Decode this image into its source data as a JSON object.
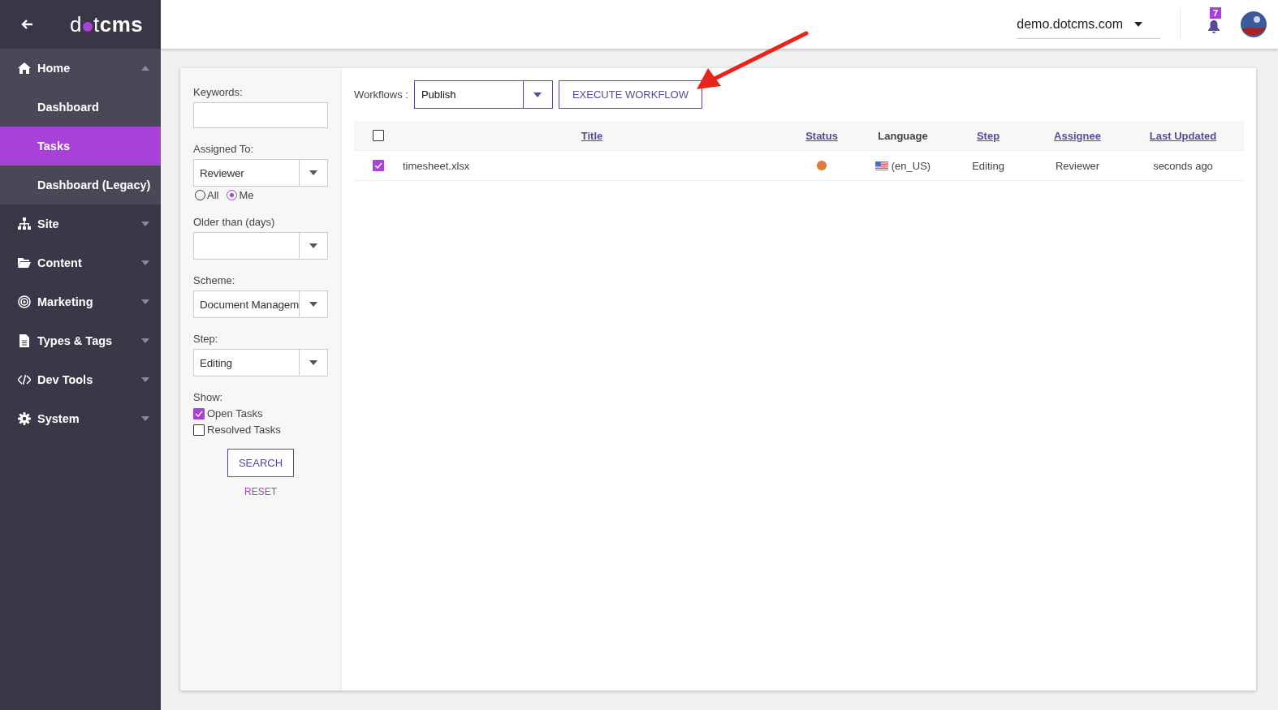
{
  "logo": {
    "lead": "d",
    "tail": "t",
    "bold": "cms"
  },
  "sidebar": {
    "items": [
      {
        "label": "Home",
        "expanded": true,
        "children": [
          {
            "label": "Dashboard",
            "selected": false
          },
          {
            "label": "Tasks",
            "selected": true
          },
          {
            "label": "Dashboard (Legacy)",
            "selected": false
          }
        ]
      },
      {
        "label": "Site",
        "expanded": false
      },
      {
        "label": "Content",
        "expanded": false
      },
      {
        "label": "Marketing",
        "expanded": false
      },
      {
        "label": "Types & Tags",
        "expanded": false
      },
      {
        "label": "Dev Tools",
        "expanded": false
      },
      {
        "label": "System",
        "expanded": false
      }
    ]
  },
  "top_bar": {
    "site": "demo.dotcms.com",
    "notifications": "7"
  },
  "filters": {
    "keywords_label": "Keywords:",
    "assigned_label": "Assigned To:",
    "assigned_value": "Reviewer",
    "assigned_options": [
      {
        "label": "All",
        "selected": false
      },
      {
        "label": "Me",
        "selected": true
      }
    ],
    "older_label": "Older than (days)",
    "scheme_label": "Scheme:",
    "scheme_value": "Document Managem",
    "step_label": "Step:",
    "step_value": "Editing",
    "show_label": "Show:",
    "show": [
      {
        "label": "Open Tasks",
        "checked": true
      },
      {
        "label": "Resolved Tasks",
        "checked": false
      }
    ],
    "search_button": "SEARCH",
    "reset_link": "RESET"
  },
  "workflows": {
    "label": "Workflows :",
    "value": "Publish",
    "execute_button": "EXECUTE WORKFLOW"
  },
  "table": {
    "all_checked": false,
    "columns": [
      {
        "label": "Title",
        "sortable": true
      },
      {
        "label": "Status",
        "sortable": true
      },
      {
        "label": "Language",
        "sortable": false
      },
      {
        "label": "Step",
        "sortable": true
      },
      {
        "label": "Assignee",
        "sortable": true
      },
      {
        "label": "Last Updated",
        "sortable": true
      }
    ],
    "rows": [
      {
        "checked": true,
        "title": "timesheet.xlsx",
        "color": "#e07b39",
        "language": "(en_US)",
        "step": "Editing",
        "assignee": "Reviewer",
        "updated": "seconds ago"
      }
    ]
  }
}
